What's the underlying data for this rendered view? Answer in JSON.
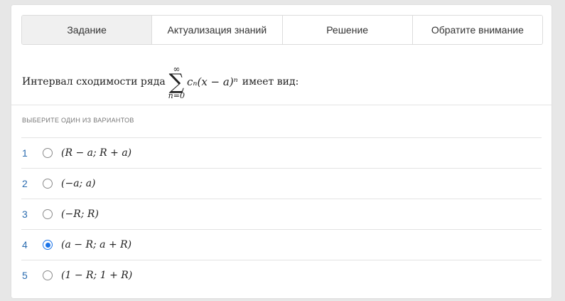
{
  "tabs": [
    {
      "label": "Задание",
      "active": true
    },
    {
      "label": "Актуализация знаний",
      "active": false
    },
    {
      "label": "Решение",
      "active": false
    },
    {
      "label": "Обратите внимание",
      "active": false
    }
  ],
  "question": {
    "prefix": "Интервал сходимости ряда",
    "sum_upper": "∞",
    "sum_lower": "n=0",
    "expression": "cₙ(x − a)ⁿ",
    "suffix": "имеет вид:"
  },
  "hint": "ВЫБЕРИТЕ ОДИН ИЗ ВАРИАНТОВ",
  "options": [
    {
      "number": "1",
      "text": "(R − a; R + a)",
      "selected": false
    },
    {
      "number": "2",
      "text": "(−a; a)",
      "selected": false
    },
    {
      "number": "3",
      "text": "(−R; R)",
      "selected": false
    },
    {
      "number": "4",
      "text": "(a − R; a + R)",
      "selected": true
    },
    {
      "number": "5",
      "text": "(1 − R; 1 + R)",
      "selected": false
    }
  ],
  "colors": {
    "accent": "#1a73e8",
    "number": "#2b6cb0",
    "background": "#e7e7e7",
    "active_tab": "#f0f0f0"
  }
}
